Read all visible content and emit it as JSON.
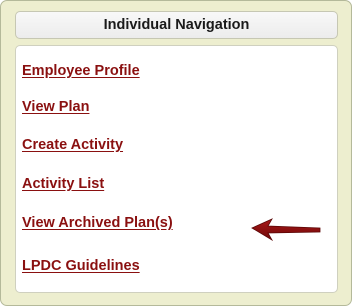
{
  "panel": {
    "title": "Individual Navigation"
  },
  "nav": {
    "items": [
      {
        "label": "Employee Profile"
      },
      {
        "label": "View Plan"
      },
      {
        "label": "Create Activity"
      },
      {
        "label": "Activity List"
      },
      {
        "label": "View Archived Plan(s)"
      },
      {
        "label": "LPDC Guidelines"
      }
    ]
  },
  "colors": {
    "link": "#8a1010",
    "panel_background": "#edeecf",
    "arrow": "#8b0d0d"
  },
  "icons": {
    "pointer": "left-arrow-icon"
  }
}
